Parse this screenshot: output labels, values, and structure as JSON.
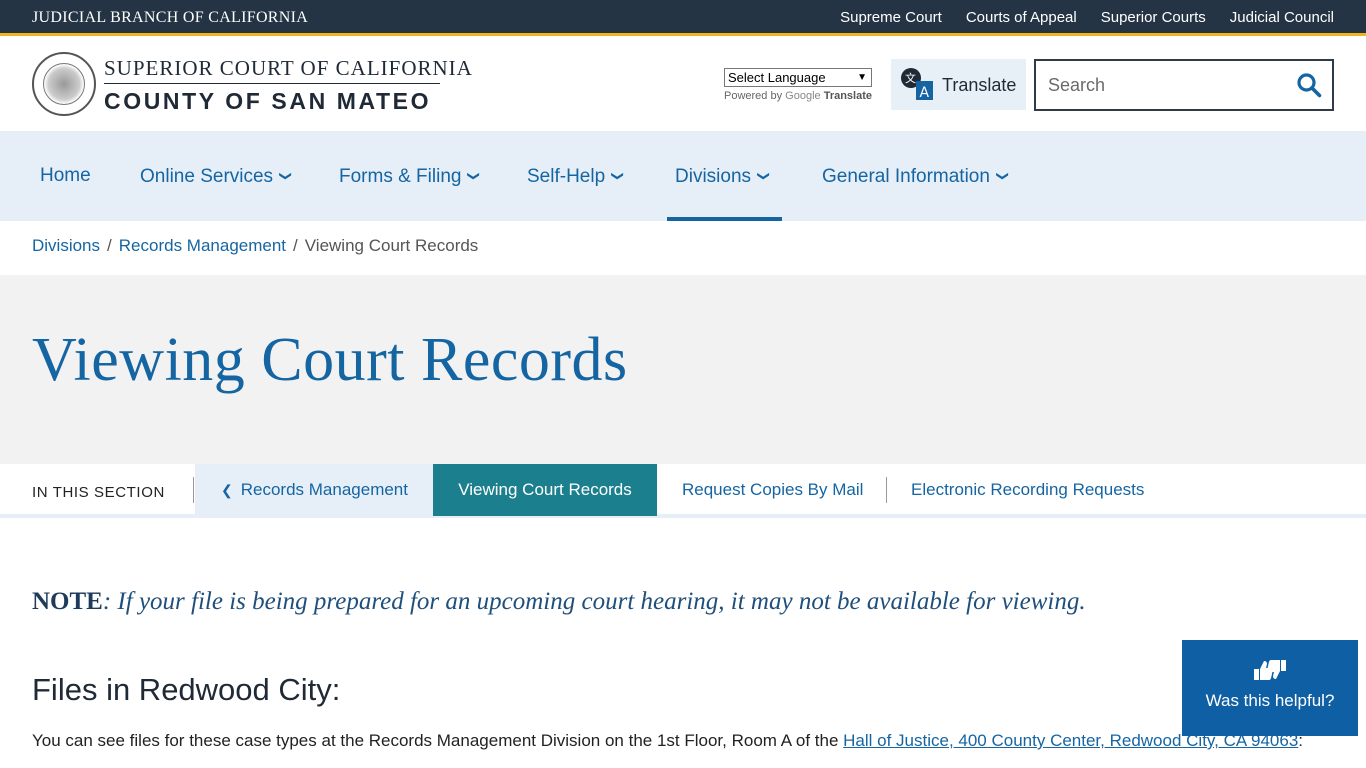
{
  "topbar": {
    "brand": "JUDICIAL BRANCH OF CALIFORNIA",
    "links": [
      "Supreme Court",
      "Courts of Appeal",
      "Superior Courts",
      "Judicial Council"
    ]
  },
  "header": {
    "logo_line1": "SUPERIOR COURT OF CALIFORNIA",
    "logo_line2": "COUNTY OF SAN MATEO",
    "language_select": "Select Language",
    "powered_by": "Powered by",
    "google": "Google",
    "translate_word": "Translate",
    "translate_button": "Translate",
    "search_placeholder": "Search"
  },
  "nav": {
    "items": [
      {
        "label": "Home",
        "has_menu": false
      },
      {
        "label": "Online Services",
        "has_menu": true
      },
      {
        "label": "Forms & Filing",
        "has_menu": true
      },
      {
        "label": "Self-Help",
        "has_menu": true
      },
      {
        "label": "Divisions",
        "has_menu": true,
        "active": true
      },
      {
        "label": "General Information",
        "has_menu": true
      }
    ]
  },
  "breadcrumb": {
    "items": [
      "Divisions",
      "Records Management"
    ],
    "current": "Viewing Court Records"
  },
  "page_title": "Viewing Court Records",
  "section_nav": {
    "label": "IN THIS SECTION",
    "parent": "Records Management",
    "active": "Viewing Court Records",
    "links": [
      "Request Copies By Mail",
      "Electronic Recording Requests"
    ]
  },
  "content": {
    "note_label": "NOTE",
    "note_text": ": If your file is being prepared for an upcoming court hearing, it may not be available for viewing.",
    "heading": "Files in Redwood City:",
    "para_before": "You can see files for these case types at the Records Management Division on the ",
    "para_bold": "1st Floor, Room A",
    "para_mid": " of the ",
    "para_link": "Hall of Justice, 400 County Center, Redwood City, CA 94063",
    "para_after": ":"
  },
  "feedback": {
    "label": "Was this helpful?"
  },
  "colors": {
    "topbar_bg": "#243444",
    "accent_gold": "#f0b323",
    "link_blue": "#1565a3",
    "nav_bg": "#e6eff7",
    "active_teal": "#1b7f8e",
    "feedback_blue": "#0f5fa5"
  }
}
